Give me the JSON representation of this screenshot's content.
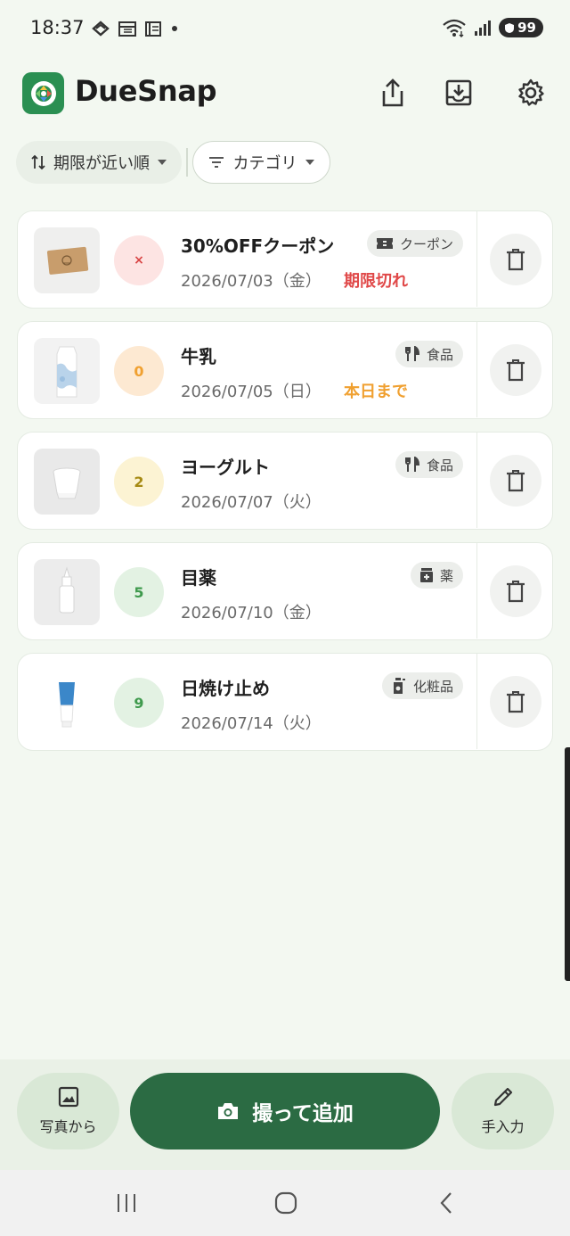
{
  "status_bar": {
    "time": "18:37",
    "battery": "99"
  },
  "header": {
    "title": "DueSnap"
  },
  "filters": {
    "sort_label": "期限が近い順",
    "category_label": "カテゴリ"
  },
  "items": [
    {
      "name": "30%OFFクーポン",
      "date": "2026/07/03（金）",
      "days": "×",
      "status": "期限切れ",
      "category": "クーポン",
      "category_icon": "ticket-icon"
    },
    {
      "name": "牛乳",
      "date": "2026/07/05（日）",
      "days": "0",
      "status": "本日まで",
      "category": "食品",
      "category_icon": "restaurant-icon"
    },
    {
      "name": "ヨーグルト",
      "date": "2026/07/07（火）",
      "days": "2",
      "status": "",
      "category": "食品",
      "category_icon": "restaurant-icon"
    },
    {
      "name": "目薬",
      "date": "2026/07/10（金）",
      "days": "5",
      "status": "",
      "category": "薬",
      "category_icon": "medicine-icon"
    },
    {
      "name": "日焼け止め",
      "date": "2026/07/14（火）",
      "days": "9",
      "status": "",
      "category": "化粧品",
      "category_icon": "cosmetics-icon"
    }
  ],
  "colors": {
    "expired_text": "#e04848",
    "today_text": "#f0a030",
    "accent": "#2b6b43"
  },
  "actions": {
    "from_photo": "写真から",
    "capture_add": "撮って追加",
    "manual_input": "手入力"
  }
}
